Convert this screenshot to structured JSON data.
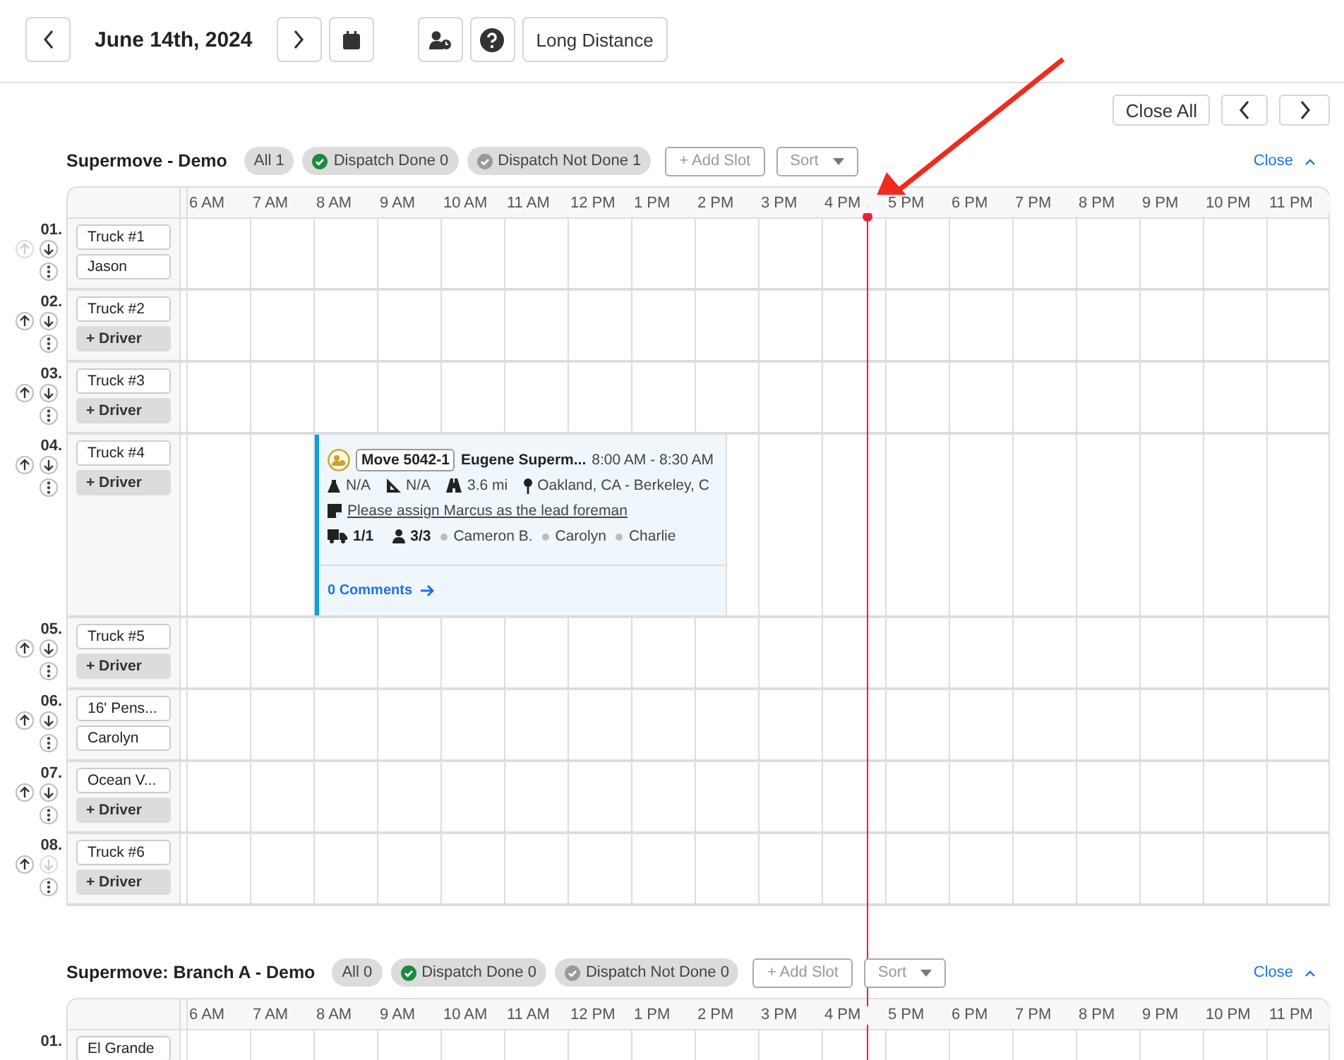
{
  "toolbar": {
    "date": "June 14th, 2024",
    "mode_button": "Long Distance"
  },
  "close_all": "Close All",
  "sections": [
    {
      "title": "Supermove - Demo",
      "filters": [
        {
          "kind": "all",
          "label": "All 1"
        },
        {
          "kind": "done",
          "label": "Dispatch Done 0"
        },
        {
          "kind": "not_done",
          "label": "Dispatch Not Done 1"
        }
      ],
      "add_slot": "+ Add Slot",
      "sort": "Sort",
      "close": "Close",
      "hours": [
        "6 AM",
        "7 AM",
        "8 AM",
        "9 AM",
        "10 AM",
        "11 AM",
        "12 PM",
        "1 PM",
        "2 PM",
        "3 PM",
        "4 PM",
        "5 PM",
        "6 PM",
        "7 PM",
        "8 PM",
        "9 PM",
        "10 PM",
        "11 PM"
      ],
      "rows": [
        {
          "number": "01.",
          "truck": "Truck #1",
          "driver": {
            "kind": "assigned",
            "label": "Jason"
          },
          "up_disabled": true,
          "down_disabled": false
        },
        {
          "number": "02.",
          "truck": "Truck #2",
          "driver": {
            "kind": "add",
            "label": "+ Driver"
          },
          "up_disabled": false,
          "down_disabled": false
        },
        {
          "number": "03.",
          "truck": "Truck #3",
          "driver": {
            "kind": "add",
            "label": "+ Driver"
          },
          "up_disabled": false,
          "down_disabled": false
        },
        {
          "number": "04.",
          "truck": "Truck #4",
          "driver": {
            "kind": "add",
            "label": "+ Driver"
          },
          "up_disabled": false,
          "down_disabled": false,
          "events": [
            {
              "move": "Move 5042-1",
              "customer": "Eugene Superm...",
              "time": "8:00 AM - 8:30 AM",
              "weight": "N/A",
              "volume": "N/A",
              "distance": "3.6 mi",
              "route": "Oakland, CA - Berkeley, C",
              "note": "Please assign Marcus as the lead foreman",
              "trucks": "1/1",
              "crew": "3/3",
              "crew_names": [
                "Cameron B.",
                "Carolyn",
                "Charlie"
              ],
              "comments": "0 Comments"
            }
          ]
        },
        {
          "number": "05.",
          "truck": "Truck #5",
          "driver": {
            "kind": "add",
            "label": "+ Driver"
          },
          "up_disabled": false,
          "down_disabled": false
        },
        {
          "number": "06.",
          "truck": "16' Pens...",
          "driver": {
            "kind": "assigned",
            "label": "Carolyn"
          },
          "up_disabled": false,
          "down_disabled": false
        },
        {
          "number": "07.",
          "truck": "Ocean V...",
          "driver": {
            "kind": "add",
            "label": "+ Driver"
          },
          "up_disabled": false,
          "down_disabled": false
        },
        {
          "number": "08.",
          "truck": "Truck #6",
          "driver": {
            "kind": "add",
            "label": "+ Driver"
          },
          "up_disabled": false,
          "down_disabled": true
        }
      ]
    },
    {
      "title": "Supermove: Branch A - Demo",
      "filters": [
        {
          "kind": "all",
          "label": "All 0"
        },
        {
          "kind": "done",
          "label": "Dispatch Done 0"
        },
        {
          "kind": "not_done",
          "label": "Dispatch Not Done 0"
        }
      ],
      "add_slot": "+ Add Slot",
      "sort": "Sort",
      "close": "Close",
      "hours": [
        "6 AM",
        "7 AM",
        "8 AM",
        "9 AM",
        "10 AM",
        "11 AM",
        "12 PM",
        "1 PM",
        "2 PM",
        "3 PM",
        "4 PM",
        "5 PM",
        "6 PM",
        "7 PM",
        "8 PM",
        "9 PM",
        "10 PM",
        "11 PM"
      ],
      "rows": [
        {
          "number": "01.",
          "truck": "El Grande"
        }
      ]
    }
  ]
}
